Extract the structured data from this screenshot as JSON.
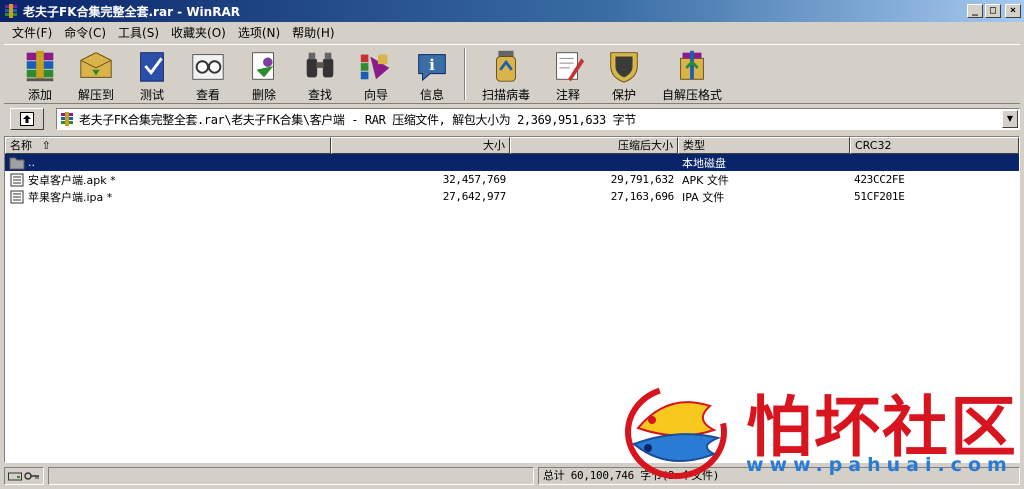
{
  "window": {
    "title": "老夫子FK合集完整全套.rar - WinRAR",
    "min": "_",
    "max": "□",
    "close": "×"
  },
  "menu": [
    "文件(F)",
    "命令(C)",
    "工具(S)",
    "收藏夹(O)",
    "选项(N)",
    "帮助(H)"
  ],
  "toolbar": {
    "add": "添加",
    "extract": "解压到",
    "test": "测试",
    "view": "查看",
    "delete": "删除",
    "find": "查找",
    "wizard": "向导",
    "info": "信息",
    "scan": "扫描病毒",
    "comment": "注释",
    "protect": "保护",
    "sfx": "自解压格式"
  },
  "address": {
    "path": "老夫子FK合集完整全套.rar\\老夫子FK合集\\客户端 - RAR 压缩文件, 解包大小为 2,369,951,633 字节"
  },
  "list": {
    "headers": {
      "name": "名称",
      "size": "大小",
      "packed": "压缩后大小",
      "type": "类型",
      "crc": "CRC32"
    },
    "rows": [
      {
        "name": "..",
        "size": "",
        "packed": "",
        "type": "本地磁盘",
        "crc": ""
      },
      {
        "name": "安卓客户端.apk *",
        "size": "32,457,769",
        "packed": "29,791,632",
        "type": "APK 文件",
        "crc": "423CC2FE"
      },
      {
        "name": "苹果客户端.ipa *",
        "size": "27,642,977",
        "packed": "27,163,696",
        "type": "IPA 文件",
        "crc": "51CF201E"
      }
    ]
  },
  "status": {
    "total": "总计 60,100,746 字节(2 个文件)"
  },
  "watermark": {
    "brand": "怕坏社区",
    "url": "www.pahuai.com"
  }
}
